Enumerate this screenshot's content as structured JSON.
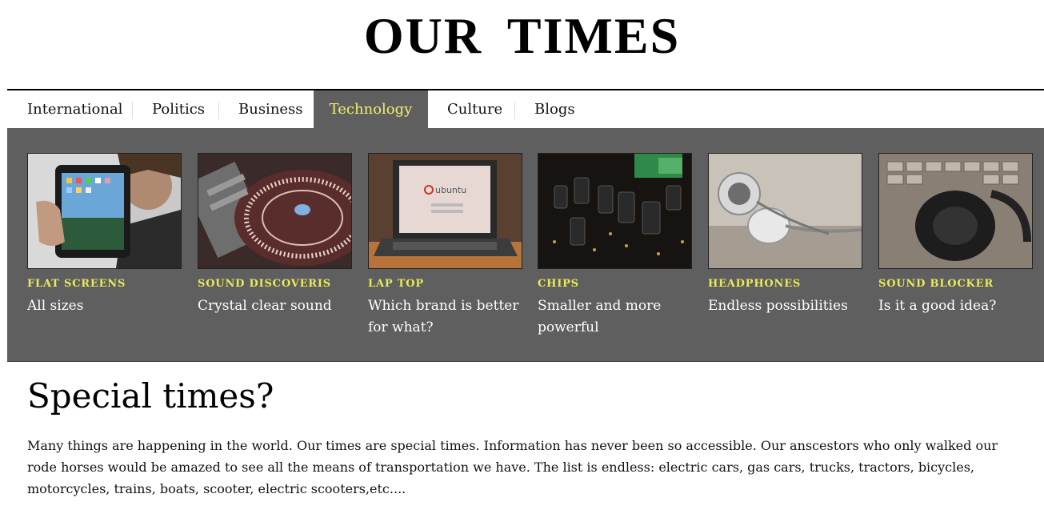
{
  "site": {
    "title": "OUR  TIMES"
  },
  "nav": {
    "items": [
      {
        "label": "International"
      },
      {
        "label": "Politics"
      },
      {
        "label": "Business"
      },
      {
        "label": "Technology"
      },
      {
        "label": "Culture"
      },
      {
        "label": "Blogs"
      }
    ],
    "active": "Technology"
  },
  "cards": [
    {
      "category": "FLAT SCREENS",
      "caption": "All sizes",
      "image": "tablet-photo"
    },
    {
      "category": "SOUND DISCOVERIS",
      "caption": "Crystal clear sound",
      "image": "turntable-photo"
    },
    {
      "category": "LAP TOP",
      "caption": "Which brand is better for what?",
      "image": "laptop-photo",
      "screen_text": "ubuntu"
    },
    {
      "category": "CHIPS",
      "caption": "Smaller and more powerful",
      "image": "circuit-board-photo"
    },
    {
      "category": "HEADPHONES",
      "caption": "Endless possibilities",
      "image": "earbuds-photo"
    },
    {
      "category": "SOUND BLOCKER",
      "caption": "Is it a good idea?",
      "image": "headphones-photo"
    }
  ],
  "article": {
    "title": "Special times?",
    "body": "Many things are happening in the world. Our times are special times. Information has never been so accessible. Our anscestors who only walked our rode horses would be amazed to see all the means of transportation we have. The list is endless: electric cars, gas cars, trucks, tractors, bicycles, motorcycles, trains, boats, scooter, electric scooters,etc...."
  },
  "colors": {
    "panel": "#5f5f5f",
    "accent": "#e8ea58",
    "active_tab_text": "#eef06a"
  }
}
